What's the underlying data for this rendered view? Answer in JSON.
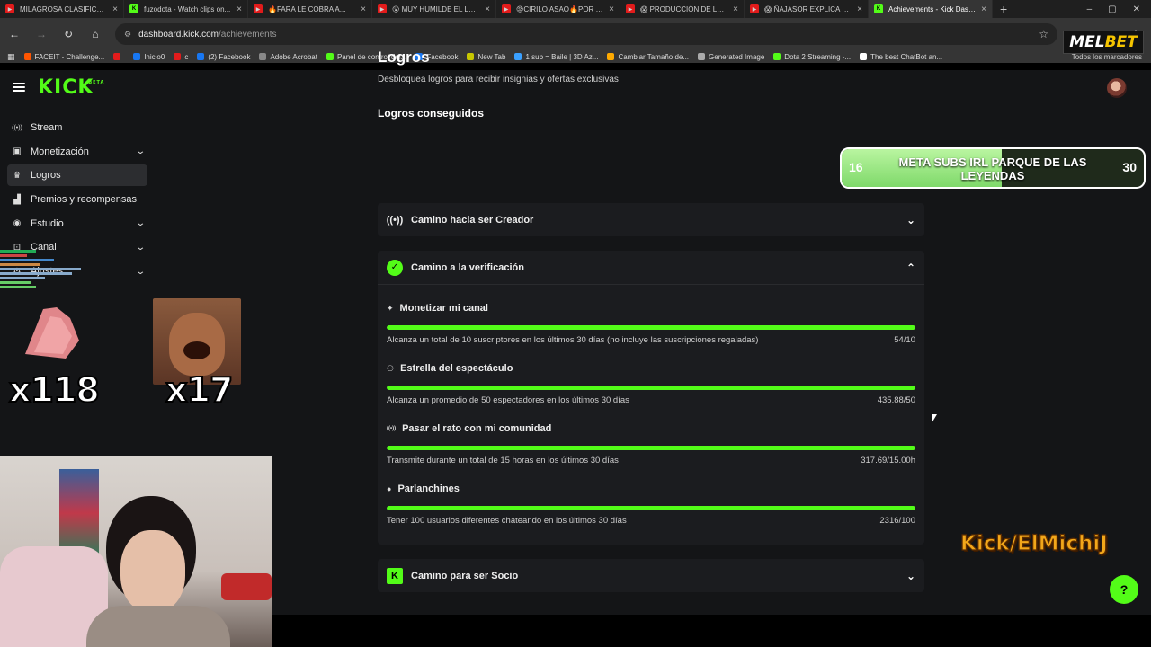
{
  "browser": {
    "tabs": [
      {
        "label": "MILAGROSA CLASIFICACI...",
        "type": "youtube"
      },
      {
        "label": "fuzodota - Watch clips on...",
        "type": "kick"
      },
      {
        "label": "🔥FARA LE COBRA A...",
        "type": "youtube"
      },
      {
        "label": "😮 MUY HUMILDE EL LO...",
        "type": "youtube"
      },
      {
        "label": "😡CIRILO ASAO🔥POR S...",
        "type": "youtube"
      },
      {
        "label": "😱 PRODUCCIÓN DE LA...",
        "type": "youtube"
      },
      {
        "label": "😱 ÑAJASOR EXPLICA PO...",
        "type": "youtube"
      },
      {
        "label": "Achievements - Kick Dash...",
        "type": "kick",
        "active": true
      }
    ],
    "url_host": "dashboard.kick.com",
    "url_path": "/achievements",
    "bookmarks": [
      {
        "label": "FACEIT - Challenge...",
        "color": "#ff5500"
      },
      {
        "label": "",
        "color": "#e21b1b"
      },
      {
        "label": "Inicio0",
        "color": "#1877f2"
      },
      {
        "label": "c",
        "color": "#e21b1b"
      },
      {
        "label": "(2) Facebook",
        "color": "#1877f2"
      },
      {
        "label": "Adobe Acrobat",
        "color": "#888888"
      },
      {
        "label": "Panel de control del...",
        "color": "#53fc18"
      },
      {
        "label": "Facebook",
        "color": "#1877f2"
      },
      {
        "label": "New Tab",
        "color": "#c7c700"
      },
      {
        "label": "1 sub = Baile | 3D Az...",
        "color": "#3aa0ff"
      },
      {
        "label": "Cambiar Tamaño de...",
        "color": "#ffaa00"
      },
      {
        "label": "Generated Image",
        "color": "#aaaaaa"
      },
      {
        "label": "Dota 2 Streaming -...",
        "color": "#53fc18"
      },
      {
        "label": "The best ChatBot an...",
        "color": "#ffffff"
      }
    ],
    "all_bookmarks_label": "Todos los marcadores"
  },
  "sidebar": {
    "items": [
      {
        "label": "Stream",
        "icon": "broadcast-icon",
        "has_chevron": false
      },
      {
        "label": "Monetización",
        "icon": "money-icon",
        "has_chevron": true
      },
      {
        "label": "Logros",
        "icon": "trophy-icon",
        "has_chevron": false,
        "active": true
      },
      {
        "label": "Premios y recompensas",
        "icon": "gift-icon",
        "has_chevron": false
      },
      {
        "label": "Estudio",
        "icon": "studio-icon",
        "has_chevron": true
      },
      {
        "label": "Canal",
        "icon": "channel-icon",
        "has_chevron": true
      },
      {
        "label": "Ajustes",
        "icon": "settings-icon",
        "has_chevron": true
      }
    ]
  },
  "main": {
    "title": "Logros",
    "subtitle": "Desbloquea logros para recibir insignias y ofertas exclusivas",
    "section_title": "Logros conseguidos",
    "accordions": [
      {
        "title": "Camino hacia ser Creador",
        "icon": "broadcast-icon",
        "expanded": false
      },
      {
        "title": "Camino a la verificación",
        "icon": "verified-badge-icon",
        "expanded": true
      },
      {
        "title": "Camino para ser Socio",
        "icon": "kick-logo-icon",
        "expanded": false
      }
    ],
    "achievements": [
      {
        "title": "Monetizar mi canal",
        "icon": "sparkle-icon",
        "description": "Alcanza un total de 10 suscriptores en los últimos 30 días (no incluye las suscripciones regaladas)",
        "progress": "54/10",
        "fill": 1.0
      },
      {
        "title": "Estrella del espectáculo",
        "icon": "viewers-icon",
        "description": "Alcanza un promedio de 50 espectadores en los últimos 30 días",
        "progress": "435.88/50",
        "fill": 1.0
      },
      {
        "title": "Pasar el rato con mi comunidad",
        "icon": "broadcast-icon",
        "description": "Transmite durante un total de 15 horas en los últimos 30 días",
        "progress": "317.69/15.00h",
        "fill": 1.0
      },
      {
        "title": "Parlanchines",
        "icon": "chat-icon",
        "description": "Tener 100 usuarios diferentes chateando en los últimos 30 días",
        "progress": "2316/100",
        "fill": 1.0
      }
    ]
  },
  "overlay": {
    "goal_start": "16",
    "goal_text": "META SUBS IRL PARQUE DE LAS LEYENDAS",
    "goal_end": "30",
    "goal_fill": 0.53,
    "sponsor_a": "MEL",
    "sponsor_b": "BET",
    "emote1_count": "x118",
    "emote2_count": "x17",
    "channel_tag": "Kick/ElMichiJ"
  }
}
